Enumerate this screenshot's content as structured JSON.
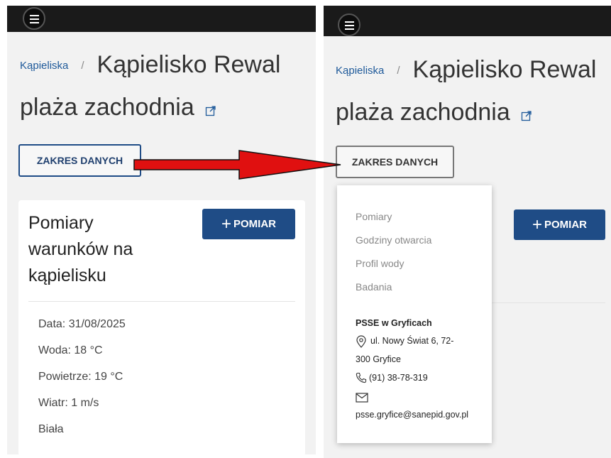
{
  "left": {
    "breadcrumb": "Kąpieliska",
    "separator": "/",
    "title_line1": "Kąpielisko Rewal",
    "title_line2": "plaża zachodnia",
    "zakres_button": "ZAKRES DANYCH",
    "card": {
      "title": [
        "Pomiary",
        "warunków na",
        "kąpielisku"
      ],
      "add_button": "POMIAR",
      "measurements": [
        "Data: 31/08/2025",
        "Woda: 18 °C",
        "Powietrze: 19 °C",
        "Wiatr: 1 m/s",
        "Biała"
      ]
    }
  },
  "right": {
    "breadcrumb": "Kąpieliska",
    "separator": "/",
    "title_line1": "Kąpielisko Rewal",
    "title_line2": "plaża zachodnia",
    "zakres_button": "ZAKRES DANYCH",
    "add_button": "POMIAR",
    "dropdown": {
      "items": [
        "Pomiary",
        "Godziny otwarcia",
        "Profil wody",
        "Badania"
      ],
      "org_name": "PSSE w Gryficach",
      "address_line1": "ul. Nowy Świat 6, 72-",
      "address_line2": "300 Gryfice",
      "phone": "(91) 38-78-319",
      "email": "psse.gryfice@sanepid.gov.pl"
    }
  },
  "icons": {
    "menu": "hamburger-menu-icon",
    "external": "external-link-icon",
    "location": "location-pin-icon",
    "phone": "phone-icon",
    "email": "envelope-icon",
    "arrow": "red-arrow-annotation"
  },
  "colors": {
    "brand_blue": "#1f4c86",
    "link_blue": "#1f5a9a",
    "topbar": "#1a1a1a",
    "arrow_red": "#e01010"
  }
}
